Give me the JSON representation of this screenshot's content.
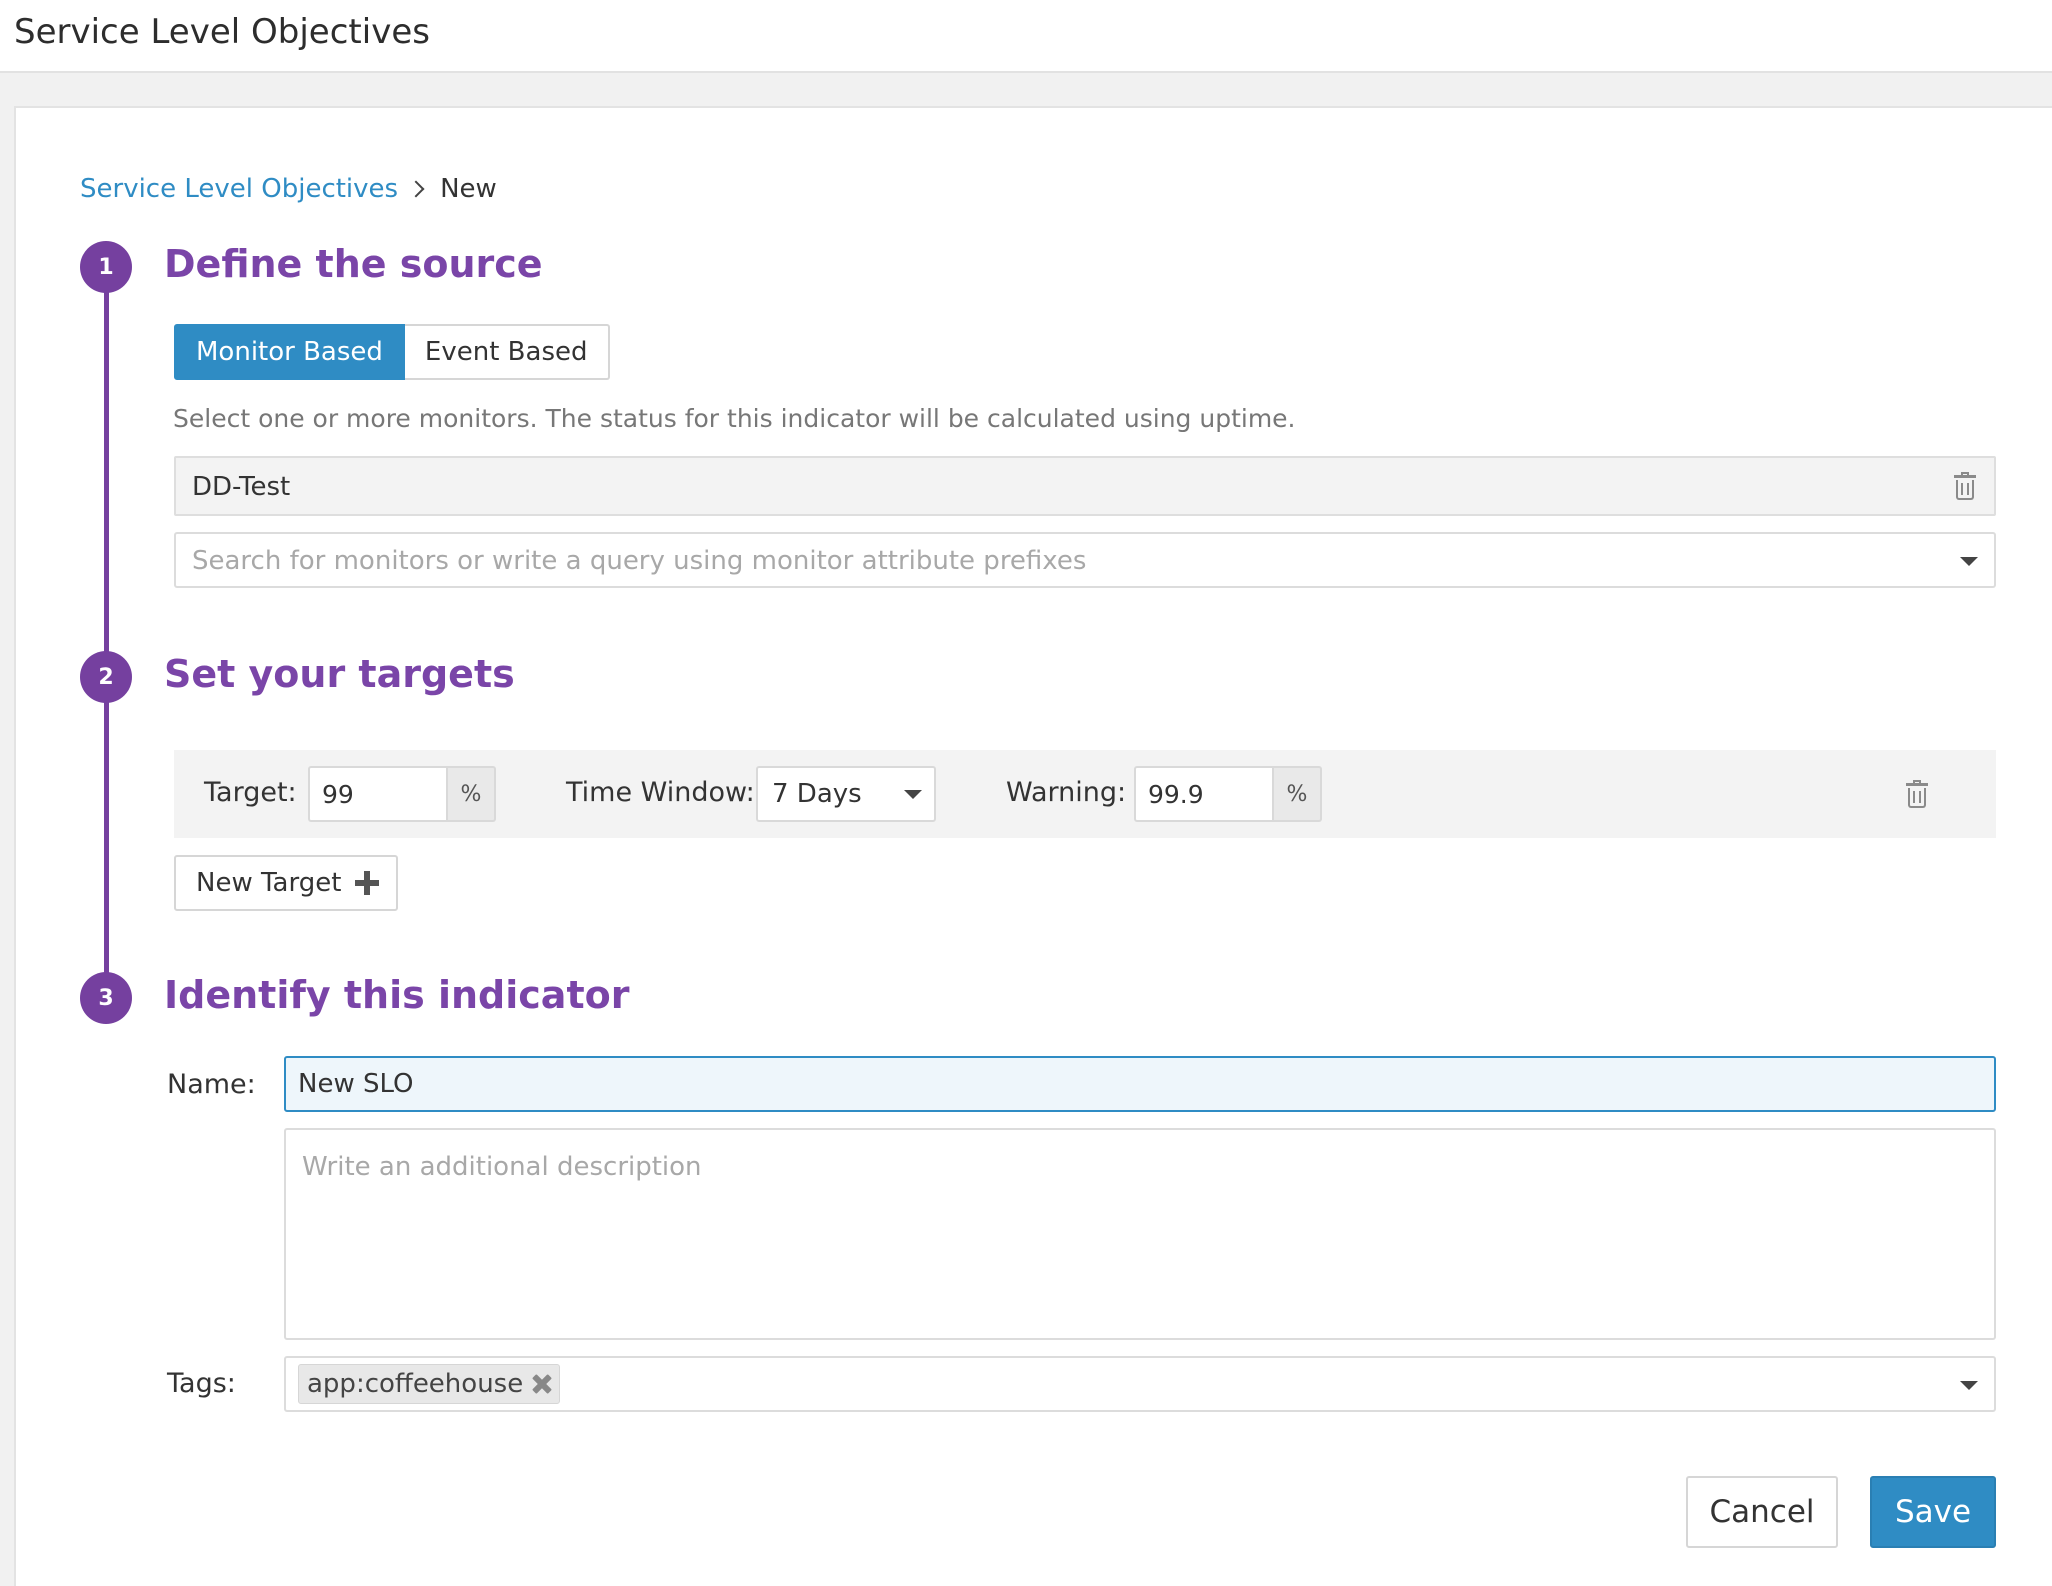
{
  "header": {
    "title": "Service Level Objectives"
  },
  "breadcrumb": {
    "parent": "Service Level Objectives",
    "current": "New"
  },
  "steps": [
    {
      "number": "1",
      "title": "Define the source"
    },
    {
      "number": "2",
      "title": "Set your targets"
    },
    {
      "number": "3",
      "title": "Identify this indicator"
    }
  ],
  "source": {
    "monitor_based_label": "Monitor Based",
    "event_based_label": "Event Based",
    "selected": "Monitor Based",
    "help_text": "Select one or more monitors. The status for this indicator will be calculated using uptime.",
    "selected_monitor": "DD-Test",
    "search_placeholder": "Search for monitors or write a query using monitor attribute prefixes"
  },
  "targets": {
    "target_label": "Target:",
    "target_value": "99",
    "percent_symbol": "%",
    "time_window_label": "Time Window:",
    "time_window_value": "7 Days",
    "warning_label": "Warning:",
    "warning_value": "99.9",
    "new_target_label": "New Target"
  },
  "identify": {
    "name_label": "Name:",
    "name_value": "New SLO",
    "description_placeholder": "Write an additional description",
    "tags_label": "Tags:",
    "tags": [
      "app:coffeehouse"
    ]
  },
  "actions": {
    "cancel_label": "Cancel",
    "save_label": "Save"
  },
  "colors": {
    "accent_blue": "#2f8cc4",
    "step_purple": "#75409f",
    "title_purple": "#7a45a8"
  },
  "icons": [
    "trash-icon",
    "caret-down-icon",
    "plus-icon",
    "close-icon",
    "chevron-right-icon"
  ]
}
